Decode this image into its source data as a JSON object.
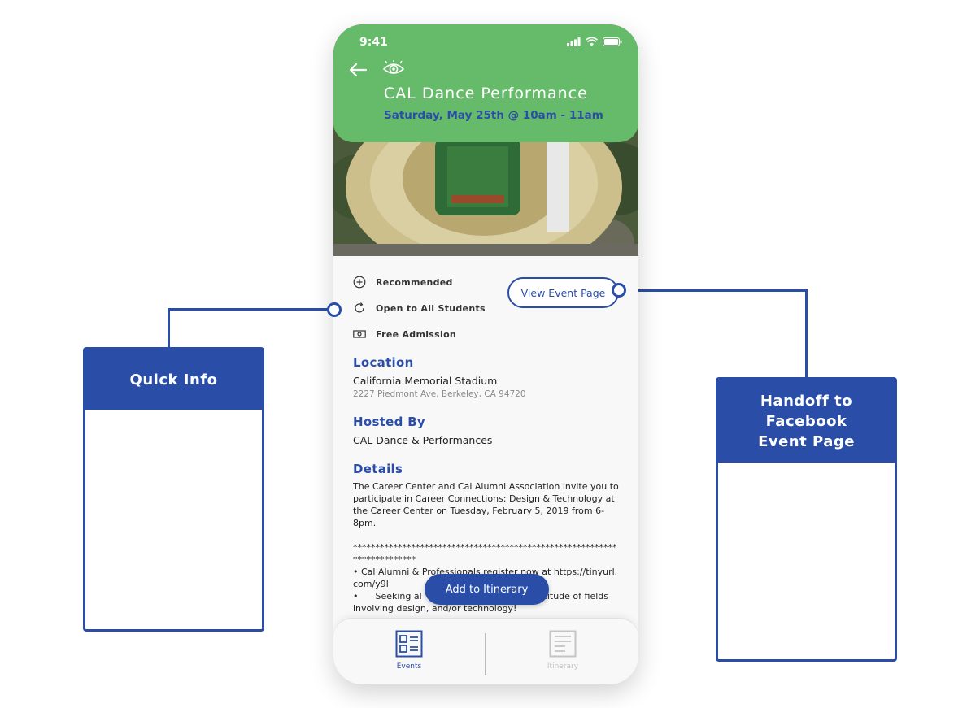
{
  "status_bar": {
    "time": "9:41"
  },
  "event": {
    "title": "CAL Dance Performance",
    "date": "Saturday, May 25th @ 10am - 11am"
  },
  "quick_info": {
    "tags": [
      {
        "icon": "plus-circle-icon",
        "label": "Recommended"
      },
      {
        "icon": "refresh-icon",
        "label": "Open to All Students"
      },
      {
        "icon": "cash-icon",
        "label": "Free Admission"
      }
    ]
  },
  "view_event_button": "View Event Page",
  "location": {
    "heading": "Location",
    "name": "California Memorial Stadium",
    "address": "2227 Piedmont Ave, Berkeley, CA 94720"
  },
  "hosted_by": {
    "heading": "Hosted By",
    "name": "CAL Dance & Performances"
  },
  "details": {
    "heading": "Details",
    "paragraph": "The Career Center and Cal Alumni Association invite you to participate in Career Connections: Design & Technology at the Career Center on Tuesday, February 5, 2019 from 6-8pm.",
    "divider": "*************************************************************************",
    "bullet1": "•      Cal Alumni & Professionals register now at https://tinyurl.com/y9l",
    "bullet2": "•      Seeking al                                  a multitude of fields involving design, and/or technology!"
  },
  "add_button": "Add to Itinerary",
  "tabs": [
    {
      "label": "Events",
      "active": true
    },
    {
      "label": "Itinerary",
      "active": false
    }
  ],
  "callouts": {
    "quick_info": "Quick Info",
    "handoff": "Handoff to Facebook Event Page"
  },
  "colors": {
    "accent": "#2a4ea8",
    "header_green": "#66bb6a"
  }
}
